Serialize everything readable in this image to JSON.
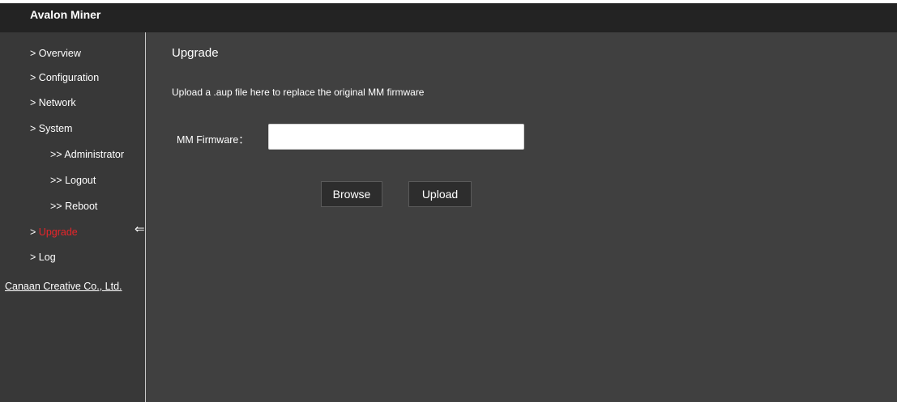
{
  "header": {
    "title": "Avalon Miner"
  },
  "sidebar": {
    "items": [
      {
        "prefix": ">",
        "label": "Overview"
      },
      {
        "prefix": ">",
        "label": "Configuration"
      },
      {
        "prefix": ">",
        "label": "Network"
      },
      {
        "prefix": ">",
        "label": "System"
      },
      {
        "prefix": ">>",
        "label": "Administrator"
      },
      {
        "prefix": ">>",
        "label": "Logout"
      },
      {
        "prefix": ">>",
        "label": "Reboot"
      },
      {
        "prefix": ">",
        "label": "Upgrade",
        "active": true
      },
      {
        "prefix": ">",
        "label": "Log"
      }
    ],
    "active_indicator_icon": "left-double-arrow-icon",
    "company_link": "Canaan Creative Co., Ltd."
  },
  "main": {
    "title": "Upgrade",
    "description": "Upload a .aup file here to replace the original MM firmware",
    "firmware_label": "MM Firmware：",
    "firmware_value": "",
    "browse_label": "Browse",
    "upload_label": "Upload"
  },
  "colors": {
    "topbar": "#232323",
    "sidebar": "#383838",
    "main": "#404040",
    "active": "#e8252a",
    "text": "#ffffff"
  }
}
